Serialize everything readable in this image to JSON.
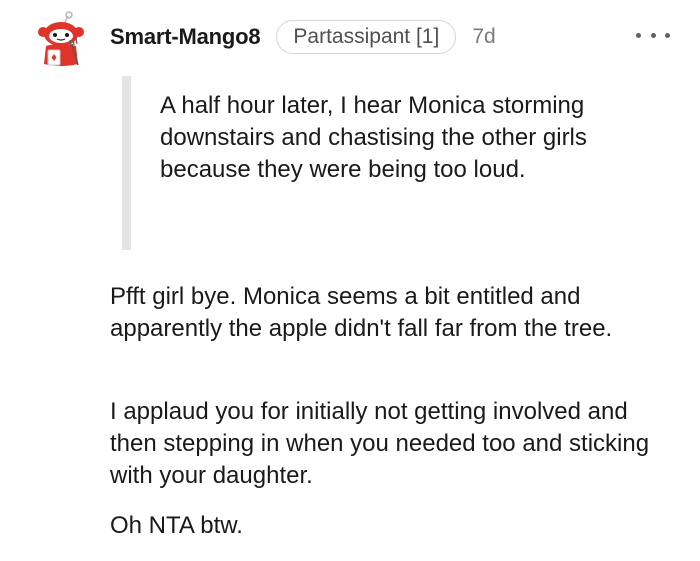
{
  "comment": {
    "username": "Smart-Mango8",
    "flair": "Partassipant [1]",
    "timestamp": "7d",
    "more_icon": "ellipsis-icon",
    "avatar_icon": "snoo-avatar-icon",
    "quote": "A half hour later, I hear Monica storming downstairs and chastising the other girls because they were being too loud.",
    "paragraphs": [
      "Pfft girl bye. Monica seems a bit entitled and apparently the apple didn't fall far from the tree.",
      "I applaud you for initially not getting involved and then stepping in when you needed too and sticking with your daughter.",
      "Oh NTA btw."
    ]
  },
  "colors": {
    "text": "#1a1a1b",
    "muted": "#787c7e",
    "quote_bar": "#e4e4e4",
    "avatar_red": "#e0332a"
  }
}
